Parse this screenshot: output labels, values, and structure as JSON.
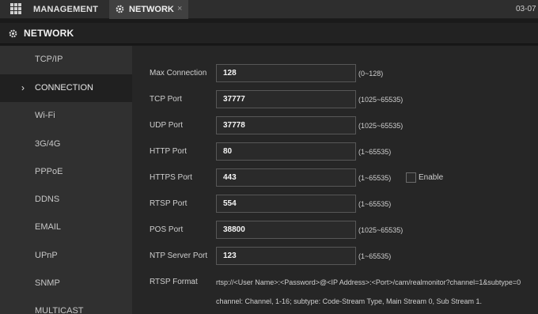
{
  "topbar": {
    "management_label": "MANAGEMENT",
    "network_tab_label": "NETWORK",
    "close_glyph": "×",
    "date": "03-07"
  },
  "section": {
    "title": "NETWORK"
  },
  "sidebar": {
    "active_indicator": "›",
    "items": [
      {
        "label": "TCP/IP"
      },
      {
        "label": "CONNECTION"
      },
      {
        "label": "Wi-Fi"
      },
      {
        "label": "3G/4G"
      },
      {
        "label": "PPPoE"
      },
      {
        "label": "DDNS"
      },
      {
        "label": "EMAIL"
      },
      {
        "label": "UPnP"
      },
      {
        "label": "SNMP"
      },
      {
        "label": "MULTICAST"
      }
    ]
  },
  "form": {
    "fields": [
      {
        "label": "Max Connection",
        "value": "128",
        "range": "(0~128)"
      },
      {
        "label": "TCP Port",
        "value": "37777",
        "range": "(1025~65535)"
      },
      {
        "label": "UDP Port",
        "value": "37778",
        "range": "(1025~65535)"
      },
      {
        "label": "HTTP Port",
        "value": "80",
        "range": "(1~65535)"
      },
      {
        "label": "HTTPS Port",
        "value": "443",
        "range": "(1~65535)"
      },
      {
        "label": "RTSP Port",
        "value": "554",
        "range": "(1~65535)"
      },
      {
        "label": "POS Port",
        "value": "38800",
        "range": "(1025~65535)"
      },
      {
        "label": "NTP Server Port",
        "value": "123",
        "range": "(1~65535)"
      }
    ],
    "https_enable_label": "Enable",
    "rtsp_format_label": "RTSP Format",
    "rtsp_format_line1": "rtsp://<User Name>:<Password>@<IP Address>:<Port>/cam/realmonitor?channel=1&subtype=0",
    "rtsp_format_line2": "channel: Channel, 1-16; subtype: Code-Stream Type, Main Stream 0, Sub Stream 1."
  },
  "colors": {
    "background": "#1a1a1a",
    "sidebar": "#303030",
    "content": "#262626",
    "active_tab": "#404040",
    "input_border": "#575757"
  },
  "icons": {
    "apps": "grid-icon",
    "network": "gear-icon",
    "close": "close-icon",
    "active_item": "chevron-right-icon"
  }
}
